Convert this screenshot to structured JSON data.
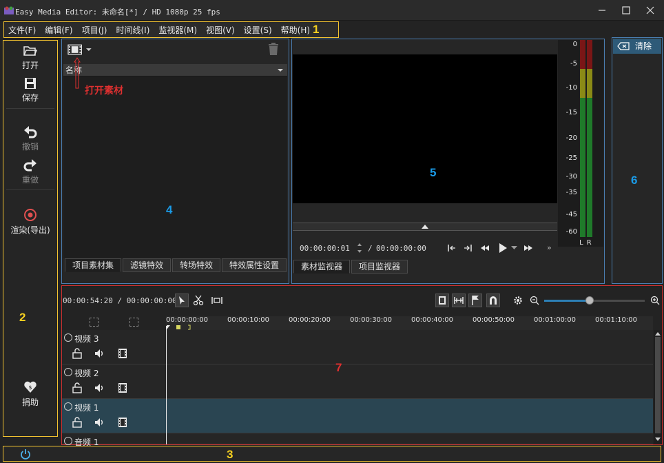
{
  "window": {
    "title": "Easy Media Editor: 未命名[*] / HD 1080p 25 fps"
  },
  "menu": [
    "文件(F)",
    "编辑(F)",
    "项目(J)",
    "时间线(I)",
    "监视器(M)",
    "视图(V)",
    "设置(S)",
    "帮助(H)"
  ],
  "left_toolbar": {
    "open": "打开",
    "save": "保存",
    "undo": "撤销",
    "redo": "重做",
    "render": "渲染(导出)",
    "donate": "捐助"
  },
  "bin": {
    "column_name": "名称",
    "callout": "打开素材",
    "tabs": [
      "项目素材集",
      "滤镜特效",
      "转场特效",
      "特效属性设置"
    ]
  },
  "monitor": {
    "position": "00:00:00:01",
    "separator": "/",
    "duration": "00:00:00:00",
    "tabs": [
      "素材监视器",
      "项目监视器"
    ],
    "meter_labels": [
      "0",
      "-5",
      "-10",
      "-15",
      "-20",
      "-25",
      "-30",
      "-35",
      "-45",
      "-60"
    ],
    "meter_channels": "L R"
  },
  "log": {
    "clear": "清除"
  },
  "timeline": {
    "position": "00:00:54:20 / 00:00:00:00",
    "ticks": [
      "00:00:00:00",
      "00:00:10:00",
      "00:00:20:00",
      "00:00:30:00",
      "00:00:40:00",
      "00:00:50:00",
      "00:01:00:00",
      "00:01:10:00"
    ],
    "tracks": [
      "视频 3",
      "视频 2",
      "视频 1",
      "音频 1"
    ],
    "zoom_level": 0.45
  },
  "annotations": {
    "a1": "1",
    "a2": "2",
    "a3": "3",
    "a4": "4",
    "a5": "5",
    "a6": "6",
    "a7": "7"
  },
  "colors": {
    "annotation_yellow": "#f5d020",
    "annotation_blue": "#1a9be8",
    "annotation_red": "#e03030",
    "selected_track": "#2a4552"
  }
}
